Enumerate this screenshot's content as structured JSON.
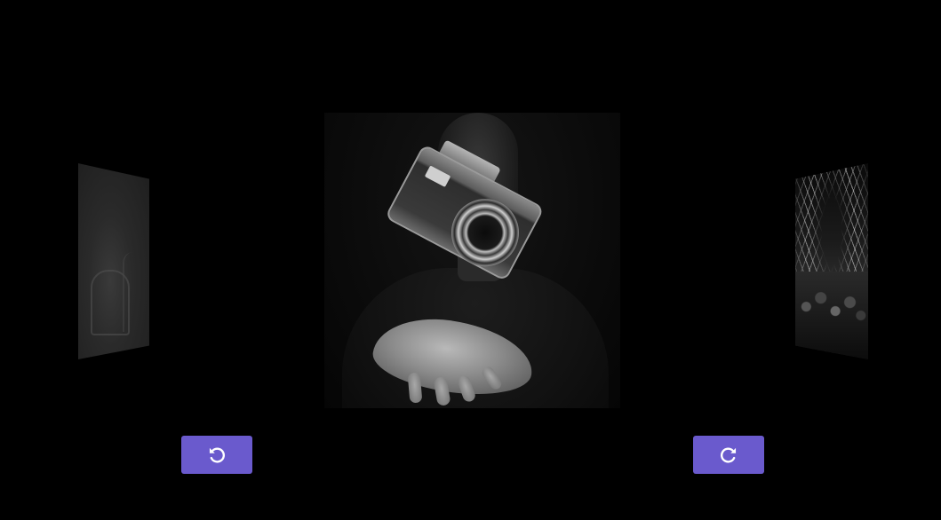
{
  "carousel": {
    "panels": [
      {
        "position": "left",
        "description_icon": "image-icon"
      },
      {
        "position": "center",
        "description_icon": "image-icon"
      },
      {
        "position": "right",
        "description_icon": "image-icon"
      }
    ],
    "controls": {
      "rotate_left_icon": "rotate-left-icon",
      "rotate_right_icon": "rotate-right-icon"
    }
  },
  "colors": {
    "background": "#000000",
    "button": "#6a5acd",
    "icon": "#ffffff"
  }
}
